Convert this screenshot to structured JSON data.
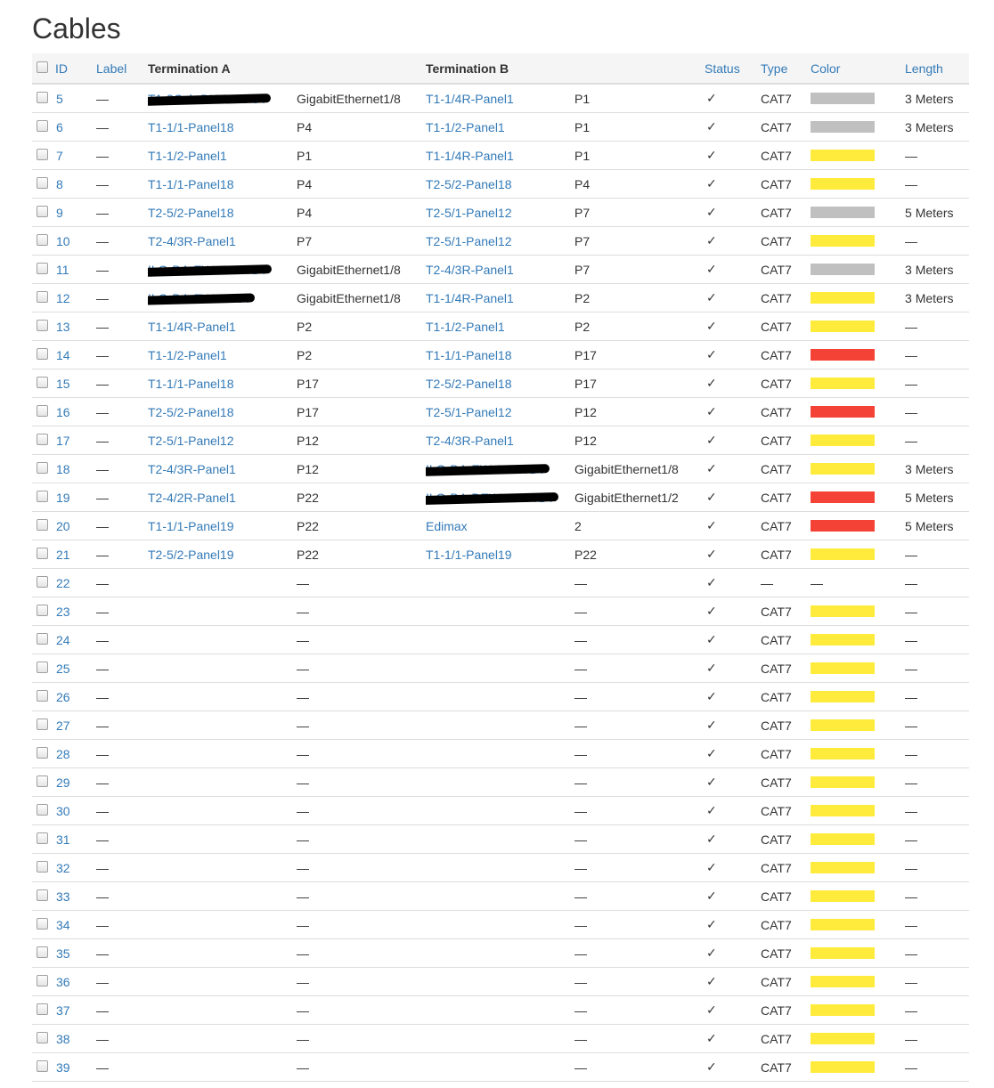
{
  "page": {
    "title": "Cables"
  },
  "headers": {
    "id": "ID",
    "label": "Label",
    "termination_a": "Termination A",
    "termination_b": "Termination B",
    "status": "Status",
    "type": "Type",
    "color": "Color",
    "length": "Length"
  },
  "colors": {
    "grey": "#c0c0c0",
    "yellow": "#ffeb3b",
    "red": "#f44336",
    "link": "#337ab7"
  },
  "rows": [
    {
      "id": "5",
      "label": "—",
      "a_device": "T1-3Cab-DKW-01-ST",
      "a_redacted": true,
      "a_port": "GigabitEthernet1/8",
      "b_device": "T1-1/4R-Panel1",
      "b_redacted": false,
      "b_port": "P1",
      "status": "✓",
      "type": "CAT7",
      "color": "grey",
      "length": "3 Meters"
    },
    {
      "id": "6",
      "label": "—",
      "a_device": "T1-1/1-Panel18",
      "a_redacted": false,
      "a_port": "P4",
      "b_device": "T1-1/2-Panel1",
      "b_redacted": false,
      "b_port": "P1",
      "status": "✓",
      "type": "CAT7",
      "color": "grey",
      "length": "3 Meters"
    },
    {
      "id": "7",
      "label": "—",
      "a_device": "T1-1/2-Panel1",
      "a_redacted": false,
      "a_port": "P1",
      "b_device": "T1-1/4R-Panel1",
      "b_redacted": false,
      "b_port": "P1",
      "status": "✓",
      "type": "CAT7",
      "color": "yellow",
      "length": "—"
    },
    {
      "id": "8",
      "label": "—",
      "a_device": "T1-1/1-Panel18",
      "a_redacted": false,
      "a_port": "P4",
      "b_device": "T2-5/2-Panel18",
      "b_redacted": false,
      "b_port": "P4",
      "status": "✓",
      "type": "CAT7",
      "color": "yellow",
      "length": "—"
    },
    {
      "id": "9",
      "label": "—",
      "a_device": "T2-5/2-Panel18",
      "a_redacted": false,
      "a_port": "P4",
      "b_device": "T2-5/1-Panel12",
      "b_redacted": false,
      "b_port": "P7",
      "status": "✓",
      "type": "CAT7",
      "color": "grey",
      "length": "5 Meters"
    },
    {
      "id": "10",
      "label": "—",
      "a_device": "T2-4/3R-Panel1",
      "a_redacted": false,
      "a_port": "P7",
      "b_device": "T2-5/1-Panel12",
      "b_redacted": false,
      "b_port": "P7",
      "status": "✓",
      "type": "CAT7",
      "color": "yellow",
      "length": "—"
    },
    {
      "id": "11",
      "label": "—",
      "a_device": "ILO-DA-EW-01-STBY",
      "a_redacted": true,
      "a_port": "GigabitEthernet1/8",
      "b_device": "T2-4/3R-Panel1",
      "b_redacted": false,
      "b_port": "P7",
      "status": "✓",
      "type": "CAT7",
      "color": "grey",
      "length": "3 Meters"
    },
    {
      "id": "12",
      "label": "—",
      "a_device": "ILO-DA-EW-01-ST",
      "a_redacted": true,
      "a_port": "GigabitEthernet1/8",
      "b_device": "T1-1/4R-Panel1",
      "b_redacted": false,
      "b_port": "P2",
      "status": "✓",
      "type": "CAT7",
      "color": "yellow",
      "length": "3 Meters"
    },
    {
      "id": "13",
      "label": "—",
      "a_device": "T1-1/4R-Panel1",
      "a_redacted": false,
      "a_port": "P2",
      "b_device": "T1-1/2-Panel1",
      "b_redacted": false,
      "b_port": "P2",
      "status": "✓",
      "type": "CAT7",
      "color": "yellow",
      "length": "—"
    },
    {
      "id": "14",
      "label": "—",
      "a_device": "T1-1/2-Panel1",
      "a_redacted": false,
      "a_port": "P2",
      "b_device": "T1-1/1-Panel18",
      "b_redacted": false,
      "b_port": "P17",
      "status": "✓",
      "type": "CAT7",
      "color": "red",
      "length": "—"
    },
    {
      "id": "15",
      "label": "—",
      "a_device": "T1-1/1-Panel18",
      "a_redacted": false,
      "a_port": "P17",
      "b_device": "T2-5/2-Panel18",
      "b_redacted": false,
      "b_port": "P17",
      "status": "✓",
      "type": "CAT7",
      "color": "yellow",
      "length": "—"
    },
    {
      "id": "16",
      "label": "—",
      "a_device": "T2-5/2-Panel18",
      "a_redacted": false,
      "a_port": "P17",
      "b_device": "T2-5/1-Panel12",
      "b_redacted": false,
      "b_port": "P12",
      "status": "✓",
      "type": "CAT7",
      "color": "red",
      "length": "—"
    },
    {
      "id": "17",
      "label": "—",
      "a_device": "T2-5/1-Panel12",
      "a_redacted": false,
      "a_port": "P12",
      "b_device": "T2-4/3R-Panel1",
      "b_redacted": false,
      "b_port": "P12",
      "status": "✓",
      "type": "CAT7",
      "color": "yellow",
      "length": "—"
    },
    {
      "id": "18",
      "label": "—",
      "a_device": "T2-4/3R-Panel1",
      "a_redacted": false,
      "a_port": "P12",
      "b_device": "ILO-DA-EW-01-STBY",
      "b_redacted": true,
      "b_port": "GigabitEthernet1/8",
      "status": "✓",
      "type": "CAT7",
      "color": "yellow",
      "length": "3 Meters"
    },
    {
      "id": "19",
      "label": "—",
      "a_device": "T2-4/2R-Panel1",
      "a_redacted": false,
      "a_port": "P22",
      "b_device": "ILO-DA-DEW-01-STBY",
      "b_redacted": true,
      "b_port": "GigabitEthernet1/2",
      "status": "✓",
      "type": "CAT7",
      "color": "red",
      "length": "5 Meters"
    },
    {
      "id": "20",
      "label": "—",
      "a_device": "T1-1/1-Panel19",
      "a_redacted": false,
      "a_port": "P22",
      "b_device": "Edimax",
      "b_redacted": false,
      "b_port": "2",
      "status": "✓",
      "type": "CAT7",
      "color": "red",
      "length": "5 Meters"
    },
    {
      "id": "21",
      "label": "—",
      "a_device": "T2-5/2-Panel19",
      "a_redacted": false,
      "a_port": "P22",
      "b_device": "T1-1/1-Panel19",
      "b_redacted": false,
      "b_port": "P22",
      "status": "✓",
      "type": "CAT7",
      "color": "yellow",
      "length": "—"
    },
    {
      "id": "22",
      "label": "—",
      "a_device": "",
      "a_redacted": false,
      "a_port": "—",
      "b_device": "",
      "b_redacted": false,
      "b_port": "—",
      "status": "✓",
      "type": "—",
      "color": "none",
      "length": "—"
    },
    {
      "id": "23",
      "label": "—",
      "a_device": "",
      "a_redacted": false,
      "a_port": "—",
      "b_device": "",
      "b_redacted": false,
      "b_port": "—",
      "status": "✓",
      "type": "CAT7",
      "color": "yellow",
      "length": "—"
    },
    {
      "id": "24",
      "label": "—",
      "a_device": "",
      "a_redacted": false,
      "a_port": "—",
      "b_device": "",
      "b_redacted": false,
      "b_port": "—",
      "status": "✓",
      "type": "CAT7",
      "color": "yellow",
      "length": "—"
    },
    {
      "id": "25",
      "label": "—",
      "a_device": "",
      "a_redacted": false,
      "a_port": "—",
      "b_device": "",
      "b_redacted": false,
      "b_port": "—",
      "status": "✓",
      "type": "CAT7",
      "color": "yellow",
      "length": "—"
    },
    {
      "id": "26",
      "label": "—",
      "a_device": "",
      "a_redacted": false,
      "a_port": "—",
      "b_device": "",
      "b_redacted": false,
      "b_port": "—",
      "status": "✓",
      "type": "CAT7",
      "color": "yellow",
      "length": "—"
    },
    {
      "id": "27",
      "label": "—",
      "a_device": "",
      "a_redacted": false,
      "a_port": "—",
      "b_device": "",
      "b_redacted": false,
      "b_port": "—",
      "status": "✓",
      "type": "CAT7",
      "color": "yellow",
      "length": "—"
    },
    {
      "id": "28",
      "label": "—",
      "a_device": "",
      "a_redacted": false,
      "a_port": "—",
      "b_device": "",
      "b_redacted": false,
      "b_port": "—",
      "status": "✓",
      "type": "CAT7",
      "color": "yellow",
      "length": "—"
    },
    {
      "id": "29",
      "label": "—",
      "a_device": "",
      "a_redacted": false,
      "a_port": "—",
      "b_device": "",
      "b_redacted": false,
      "b_port": "—",
      "status": "✓",
      "type": "CAT7",
      "color": "yellow",
      "length": "—"
    },
    {
      "id": "30",
      "label": "—",
      "a_device": "",
      "a_redacted": false,
      "a_port": "—",
      "b_device": "",
      "b_redacted": false,
      "b_port": "—",
      "status": "✓",
      "type": "CAT7",
      "color": "yellow",
      "length": "—"
    },
    {
      "id": "31",
      "label": "—",
      "a_device": "",
      "a_redacted": false,
      "a_port": "—",
      "b_device": "",
      "b_redacted": false,
      "b_port": "—",
      "status": "✓",
      "type": "CAT7",
      "color": "yellow",
      "length": "—"
    },
    {
      "id": "32",
      "label": "—",
      "a_device": "",
      "a_redacted": false,
      "a_port": "—",
      "b_device": "",
      "b_redacted": false,
      "b_port": "—",
      "status": "✓",
      "type": "CAT7",
      "color": "yellow",
      "length": "—"
    },
    {
      "id": "33",
      "label": "—",
      "a_device": "",
      "a_redacted": false,
      "a_port": "—",
      "b_device": "",
      "b_redacted": false,
      "b_port": "—",
      "status": "✓",
      "type": "CAT7",
      "color": "yellow",
      "length": "—"
    },
    {
      "id": "34",
      "label": "—",
      "a_device": "",
      "a_redacted": false,
      "a_port": "—",
      "b_device": "",
      "b_redacted": false,
      "b_port": "—",
      "status": "✓",
      "type": "CAT7",
      "color": "yellow",
      "length": "—"
    },
    {
      "id": "35",
      "label": "—",
      "a_device": "",
      "a_redacted": false,
      "a_port": "—",
      "b_device": "",
      "b_redacted": false,
      "b_port": "—",
      "status": "✓",
      "type": "CAT7",
      "color": "yellow",
      "length": "—"
    },
    {
      "id": "36",
      "label": "—",
      "a_device": "",
      "a_redacted": false,
      "a_port": "—",
      "b_device": "",
      "b_redacted": false,
      "b_port": "—",
      "status": "✓",
      "type": "CAT7",
      "color": "yellow",
      "length": "—"
    },
    {
      "id": "37",
      "label": "—",
      "a_device": "",
      "a_redacted": false,
      "a_port": "—",
      "b_device": "",
      "b_redacted": false,
      "b_port": "—",
      "status": "✓",
      "type": "CAT7",
      "color": "yellow",
      "length": "—"
    },
    {
      "id": "38",
      "label": "—",
      "a_device": "",
      "a_redacted": false,
      "a_port": "—",
      "b_device": "",
      "b_redacted": false,
      "b_port": "—",
      "status": "✓",
      "type": "CAT7",
      "color": "yellow",
      "length": "—"
    },
    {
      "id": "39",
      "label": "—",
      "a_device": "",
      "a_redacted": false,
      "a_port": "—",
      "b_device": "",
      "b_redacted": false,
      "b_port": "—",
      "status": "✓",
      "type": "CAT7",
      "color": "yellow",
      "length": "—"
    }
  ]
}
